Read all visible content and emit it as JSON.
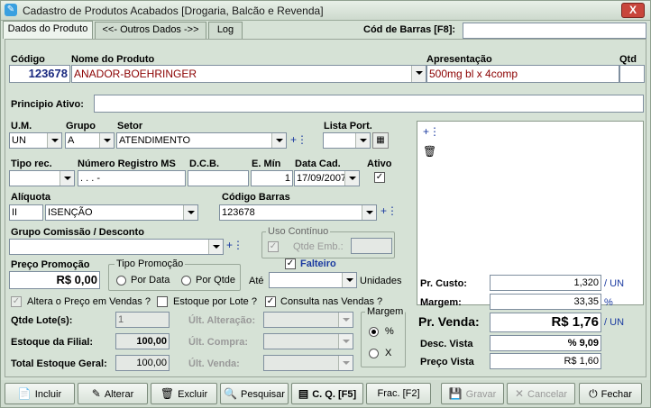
{
  "window": {
    "title": "Cadastro de Produtos Acabados [Drogaria, Balcão e Revenda]",
    "close": "X"
  },
  "tabs": [
    "Dados do Produto",
    "<<- Outros Dados ->>",
    "Log"
  ],
  "barcode_search": {
    "label": "Cód de Barras [F8]:",
    "value": ""
  },
  "labels": {
    "codigo": "Código",
    "nome": "Nome do Produto",
    "apresentacao": "Apresentação",
    "qtd": "Qtd",
    "principio": "Principio Ativo:",
    "um": "U.M.",
    "grupo": "Grupo",
    "setor": "Setor",
    "lista_port": "Lista Port.",
    "tipo_rec": "Tipo rec.",
    "registro_ms": "Número Registro MS",
    "dcb": "D.C.B.",
    "e_min": "E. Mín",
    "data_cad": "Data Cad.",
    "ativo": "Ativo",
    "aliquota": "Alíquota",
    "codigo_barras": "Código Barras",
    "grupo_comissao": "Grupo Comissão / Desconto",
    "uso_continuo": "Uso Contínuo",
    "qtde_emb": "Qtde Emb.:",
    "preco_promocao": "Preço Promoção",
    "tipo_promocao": "Tipo Promoção",
    "por_data": "Por Data",
    "por_qtde": "Por Qtde",
    "ate": "Até",
    "unidades": "Unidades",
    "falteiro": "Falteiro",
    "altera_preco": "Altera o Preço em Vendas ?",
    "estoque_lote": "Estoque por Lote ?",
    "consulta_vendas": "Consulta nas Vendas ?",
    "qtde_lotes": "Qtde Lote(s):",
    "estoque_filial": "Estoque da Filial:",
    "total_estoque": "Total Estoque Geral:",
    "ult_alteracao": "Últ. Alteração:",
    "ult_compra": "Últ. Compra:",
    "ult_venda": "Últ. Venda:",
    "margem_group": "Margem",
    "pct": "%",
    "x": "X",
    "pr_custo": "Pr. Custo:",
    "margem": "Margem:",
    "pr_venda": "Pr. Venda:",
    "desc_vista": "Desc. Vista",
    "preco_vista": "Preço Vista",
    "un": "UN",
    "pct_unit": "%"
  },
  "values": {
    "codigo": "123678",
    "nome": "ANADOR-BOEHRINGER",
    "apresentacao": "500mg bl x 4comp",
    "qtd": "",
    "principio": "",
    "um": "UN",
    "grupo": "A",
    "setor": "ATENDIMENTO",
    "lista_port": "",
    "tipo_rec": "",
    "registro_ms": " .   .   .   -",
    "dcb": "",
    "e_min": "1",
    "data_cad": "17/09/2007",
    "aliquota_code": "II",
    "aliquota_desc": "ISENÇÃO",
    "codigo_barras": "123678",
    "grupo_comissao": "",
    "qtde_emb": "",
    "preco_promocao": "R$ 0,00",
    "ate": "",
    "qtde_lotes": "1",
    "estoque_filial": "100,00",
    "total_estoque": "100,00",
    "pr_custo": "1,320",
    "margem": "33,35",
    "pr_venda": "R$ 1,76",
    "desc_vista": "% 9,09",
    "preco_vista": "R$ 1,60"
  },
  "buttons": [
    {
      "label": "Incluir",
      "icon": "new-doc-icon"
    },
    {
      "label": "Alterar",
      "icon": "edit-icon"
    },
    {
      "label": "Excluir",
      "icon": "trash-icon"
    },
    {
      "label": "Pesquisar",
      "icon": "search-icon"
    },
    {
      "label": "C. Q. [F5]",
      "icon": "cq-icon"
    },
    {
      "label": "Frac. [F2]",
      "icon": ""
    },
    {
      "label": "Gravar",
      "icon": "save-icon"
    },
    {
      "label": "Cancelar",
      "icon": "cancel-icon"
    },
    {
      "label": "Fechar",
      "icon": "exit-icon"
    }
  ],
  "colors": {
    "product_name": "#8b0000",
    "code": "#1a2a80",
    "accent_blue": "#1a3aa0"
  }
}
